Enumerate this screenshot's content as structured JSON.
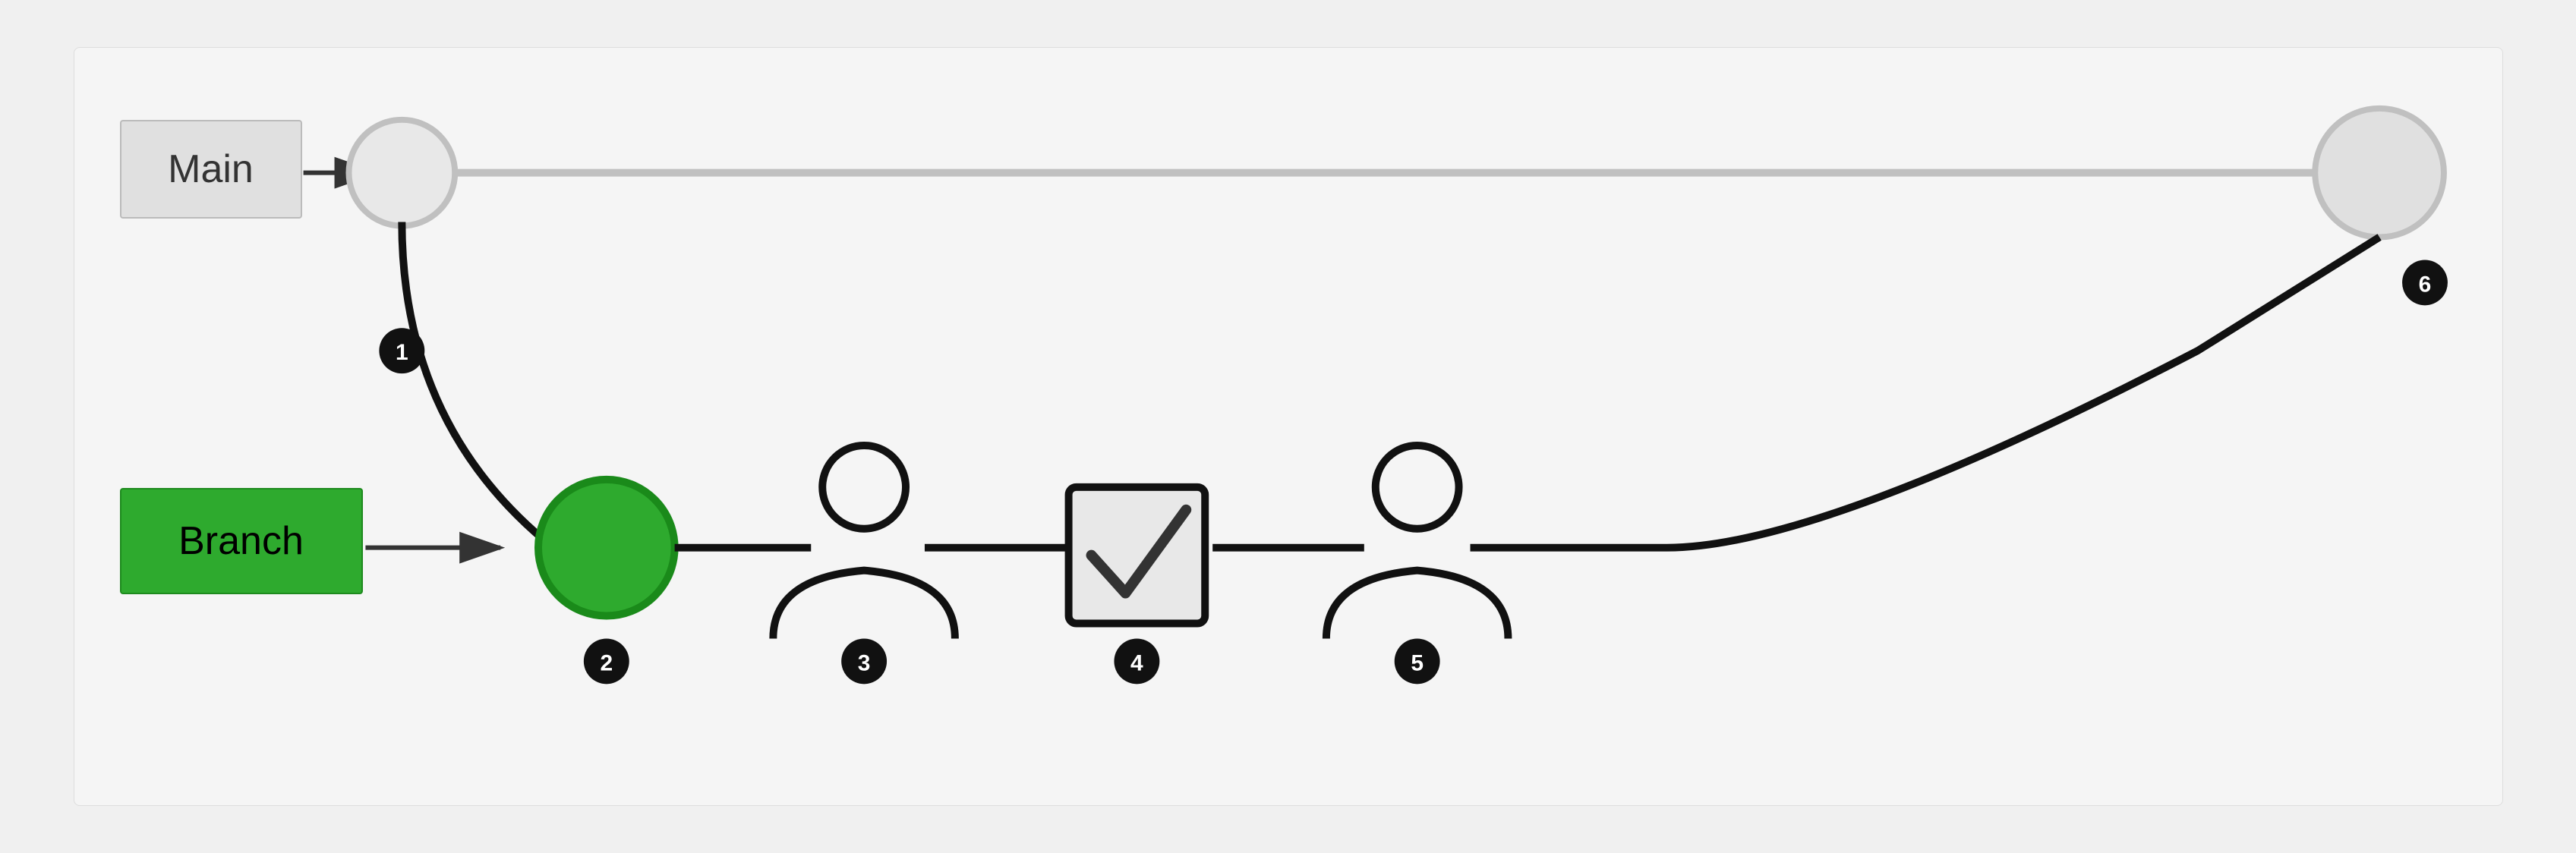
{
  "labels": {
    "main": "Main",
    "branch": "Branch"
  },
  "badges": [
    "1",
    "2",
    "3",
    "4",
    "5",
    "6"
  ],
  "colors": {
    "background": "#f4f4f4",
    "mainBox": "#e0e0e0",
    "branchBox": "#2eaa2e",
    "circle_empty": "#d0d0d0",
    "circle_filled": "#2eaa2e",
    "line_main": "#c0c0c0",
    "line_branch": "#111",
    "badge": "#111"
  }
}
